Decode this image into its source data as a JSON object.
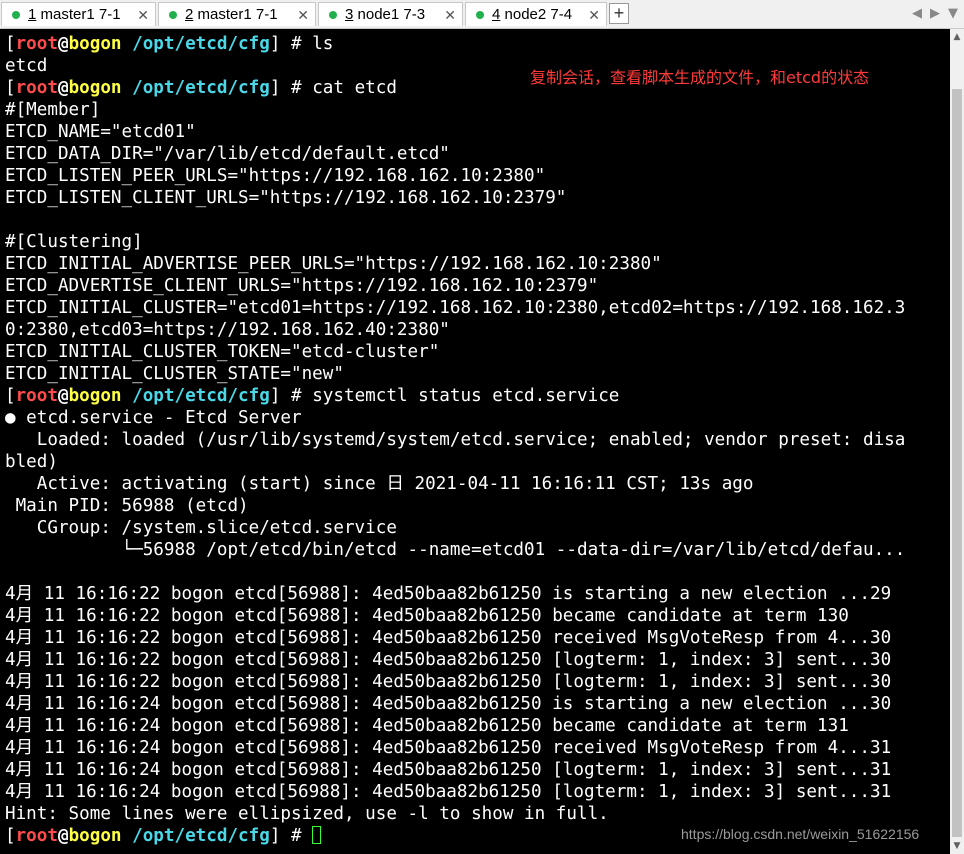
{
  "tabs": [
    {
      "num": "1",
      "label": " master1 7-1",
      "close": "✕"
    },
    {
      "num": "2",
      "label": " master1 7-1",
      "close": "✕"
    },
    {
      "num": "3",
      "label": " node1 7-3",
      "close": "✕"
    },
    {
      "num": "4",
      "label": " node2 7-4",
      "close": "✕"
    }
  ],
  "add_tab": "+",
  "nav": {
    "left": "◀",
    "right": "▶",
    "menu": "▼"
  },
  "prompt": {
    "user": "root",
    "at": "@",
    "host": "bogon",
    "path": "/opt/etcd/cfg",
    "symbol": "#"
  },
  "commands": {
    "c1": "ls",
    "c2": "cat etcd",
    "c3": "systemctl status etcd.service"
  },
  "output": {
    "ls": "etcd",
    "cat": [
      "#[Member]",
      "ETCD_NAME=\"etcd01\"",
      "ETCD_DATA_DIR=\"/var/lib/etcd/default.etcd\"",
      "ETCD_LISTEN_PEER_URLS=\"https://192.168.162.10:2380\"",
      "ETCD_LISTEN_CLIENT_URLS=\"https://192.168.162.10:2379\"",
      "",
      "#[Clustering]",
      "ETCD_INITIAL_ADVERTISE_PEER_URLS=\"https://192.168.162.10:2380\"",
      "ETCD_ADVERTISE_CLIENT_URLS=\"https://192.168.162.10:2379\"",
      "ETCD_INITIAL_CLUSTER=\"etcd01=https://192.168.162.10:2380,etcd02=https://192.168.162.3",
      "0:2380,etcd03=https://192.168.162.40:2380\"",
      "ETCD_INITIAL_CLUSTER_TOKEN=\"etcd-cluster\"",
      "ETCD_INITIAL_CLUSTER_STATE=\"new\""
    ],
    "status": [
      "● etcd.service - Etcd Server",
      "   Loaded: loaded (/usr/lib/systemd/system/etcd.service; enabled; vendor preset: disa",
      "bled)",
      "   Active: activating (start) since 日 2021-04-11 16:16:11 CST; 13s ago",
      " Main PID: 56988 (etcd)",
      "   CGroup: /system.slice/etcd.service",
      "           └─56988 /opt/etcd/bin/etcd --name=etcd01 --data-dir=/var/lib/etcd/defau...",
      "",
      "4月 11 16:16:22 bogon etcd[56988]: 4ed50baa82b61250 is starting a new election ...29",
      "4月 11 16:16:22 bogon etcd[56988]: 4ed50baa82b61250 became candidate at term 130",
      "4月 11 16:16:22 bogon etcd[56988]: 4ed50baa82b61250 received MsgVoteResp from 4...30",
      "4月 11 16:16:22 bogon etcd[56988]: 4ed50baa82b61250 [logterm: 1, index: 3] sent...30",
      "4月 11 16:16:22 bogon etcd[56988]: 4ed50baa82b61250 [logterm: 1, index: 3] sent...30",
      "4月 11 16:16:24 bogon etcd[56988]: 4ed50baa82b61250 is starting a new election ...30",
      "4月 11 16:16:24 bogon etcd[56988]: 4ed50baa82b61250 became candidate at term 131",
      "4月 11 16:16:24 bogon etcd[56988]: 4ed50baa82b61250 received MsgVoteResp from 4...31",
      "4月 11 16:16:24 bogon etcd[56988]: 4ed50baa82b61250 [logterm: 1, index: 3] sent...31",
      "4月 11 16:16:24 bogon etcd[56988]: 4ed50baa82b61250 [logterm: 1, index: 3] sent...31",
      "Hint: Some lines were ellipsized, use -l to show in full."
    ]
  },
  "annotation": "复制会话，查看脚本生成的文件，和etcd的状态",
  "watermark": "https://blog.csdn.net/weixin_51622156",
  "scrollbar": {
    "up": "▲",
    "down": "▼"
  }
}
